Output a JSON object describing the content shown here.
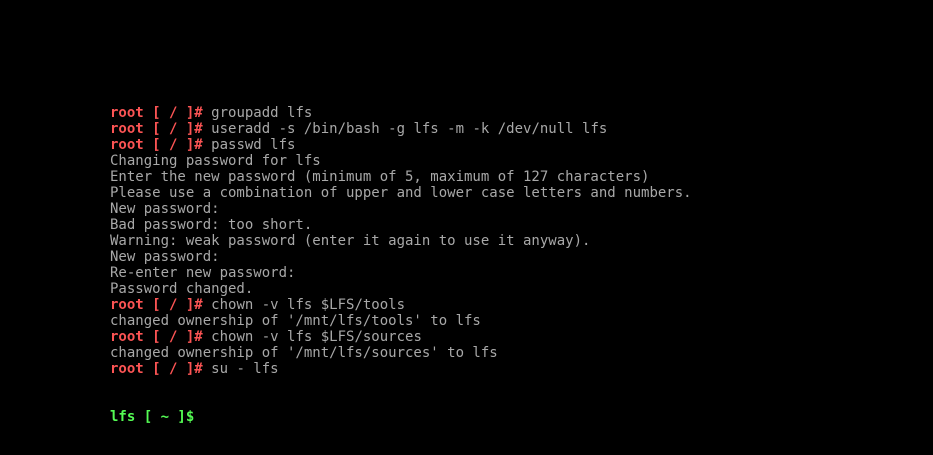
{
  "colors": {
    "background": "#000000",
    "output_text": "#a8a8a8",
    "root_prompt": "#fc5454",
    "user_prompt": "#54fc54"
  },
  "terminal": {
    "lines": [
      {
        "type": "command",
        "prompt": "root [ / ]# ",
        "text": "groupadd lfs"
      },
      {
        "type": "command",
        "prompt": "root [ / ]# ",
        "text": "useradd -s /bin/bash -g lfs -m -k /dev/null lfs"
      },
      {
        "type": "command",
        "prompt": "root [ / ]# ",
        "text": "passwd lfs"
      },
      {
        "type": "output",
        "text": "Changing password for lfs"
      },
      {
        "type": "output",
        "text": "Enter the new password (minimum of 5, maximum of 127 characters)"
      },
      {
        "type": "output",
        "text": "Please use a combination of upper and lower case letters and numbers."
      },
      {
        "type": "output",
        "text": "New password:"
      },
      {
        "type": "output",
        "text": "Bad password: too short."
      },
      {
        "type": "output",
        "text": "Warning: weak password (enter it again to use it anyway)."
      },
      {
        "type": "output",
        "text": "New password:"
      },
      {
        "type": "output",
        "text": "Re-enter new password:"
      },
      {
        "type": "output",
        "text": "Password changed."
      },
      {
        "type": "command",
        "prompt": "root [ / ]# ",
        "text": "chown -v lfs $LFS/tools"
      },
      {
        "type": "output",
        "text": "changed ownership of '/mnt/lfs/tools' to lfs"
      },
      {
        "type": "command",
        "prompt": "root [ / ]# ",
        "text": "chown -v lfs $LFS/sources"
      },
      {
        "type": "output",
        "text": "changed ownership of '/mnt/lfs/sources' to lfs"
      },
      {
        "type": "command",
        "prompt": "root [ / ]# ",
        "text": "su - lfs"
      }
    ],
    "current_prompt": "lfs [ ~ ]$",
    "current_input": ""
  }
}
